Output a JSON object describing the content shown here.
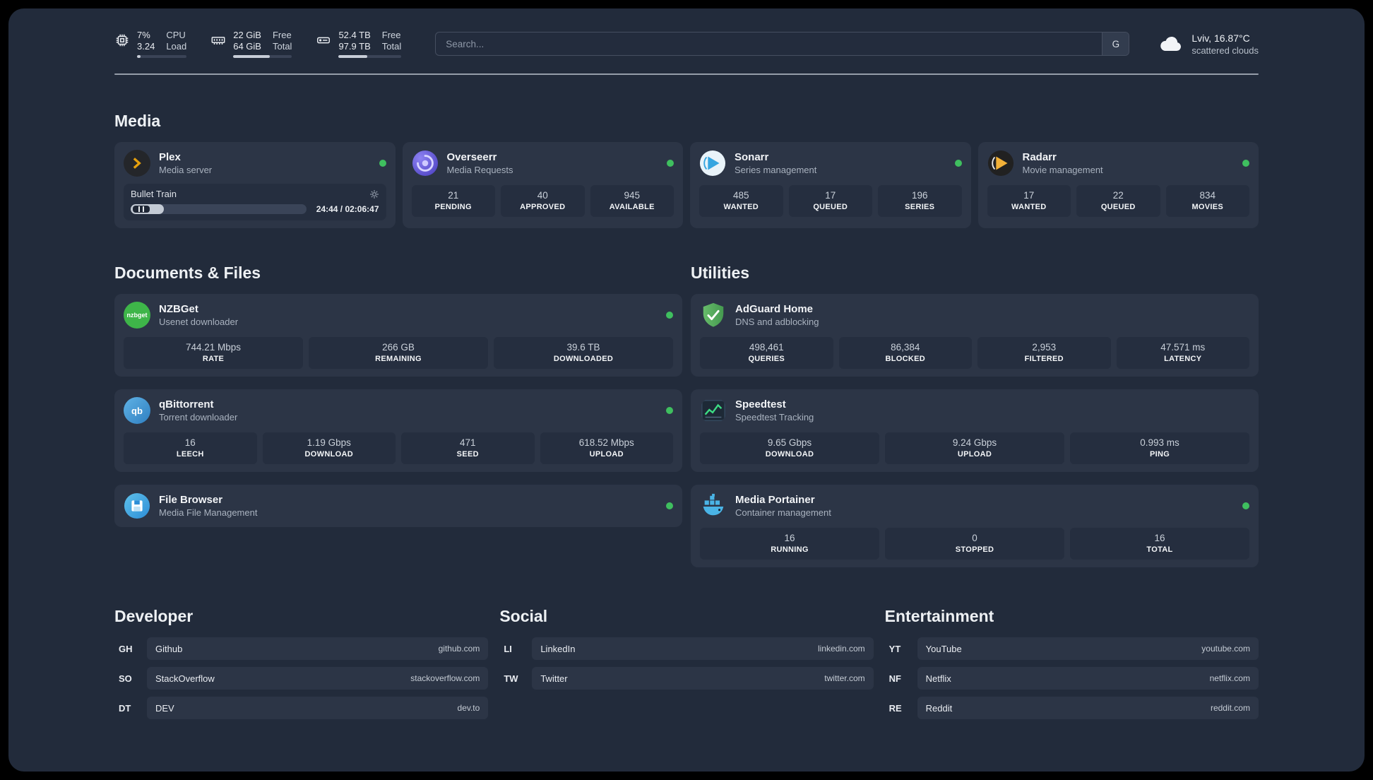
{
  "topbar": {
    "cpu": {
      "value_top": "7%",
      "label_top": "CPU",
      "value_bottom": "3.24",
      "label_bottom": "Load",
      "bar_percent": 7
    },
    "ram": {
      "value_top": "22 GiB",
      "label_top": "Free",
      "value_bottom": "64 GiB",
      "label_bottom": "Total",
      "bar_percent": 62
    },
    "disk": {
      "value_top": "52.4 TB",
      "label_top": "Free",
      "value_bottom": "97.9 TB",
      "label_bottom": "Total",
      "bar_percent": 46
    },
    "search": {
      "placeholder": "Search...",
      "button": "G"
    },
    "weather": {
      "location": "Lviv, 16.87°C",
      "condition": "scattered clouds"
    }
  },
  "sections": {
    "media": "Media",
    "documents": "Documents & Files",
    "utilities": "Utilities",
    "developer": "Developer",
    "social": "Social",
    "entertainment": "Entertainment"
  },
  "media": {
    "plex": {
      "name": "Plex",
      "desc": "Media server",
      "now_playing": "Bullet Train",
      "time": "24:44 / 02:06:47",
      "progress_percent": 19
    },
    "overseerr": {
      "name": "Overseerr",
      "desc": "Media Requests",
      "stats": [
        {
          "value": "21",
          "label": "PENDING"
        },
        {
          "value": "40",
          "label": "APPROVED"
        },
        {
          "value": "945",
          "label": "AVAILABLE"
        }
      ]
    },
    "sonarr": {
      "name": "Sonarr",
      "desc": "Series management",
      "stats": [
        {
          "value": "485",
          "label": "WANTED"
        },
        {
          "value": "17",
          "label": "QUEUED"
        },
        {
          "value": "196",
          "label": "SERIES"
        }
      ]
    },
    "radarr": {
      "name": "Radarr",
      "desc": "Movie management",
      "stats": [
        {
          "value": "17",
          "label": "WANTED"
        },
        {
          "value": "22",
          "label": "QUEUED"
        },
        {
          "value": "834",
          "label": "MOVIES"
        }
      ]
    }
  },
  "documents": {
    "nzbget": {
      "name": "NZBGet",
      "desc": "Usenet downloader",
      "icon_text": "nzbget",
      "stats": [
        {
          "value": "744.21 Mbps",
          "label": "RATE"
        },
        {
          "value": "266 GB",
          "label": "REMAINING"
        },
        {
          "value": "39.6 TB",
          "label": "DOWNLOADED"
        }
      ]
    },
    "qbittorrent": {
      "name": "qBittorrent",
      "desc": "Torrent downloader",
      "icon_text": "qb",
      "stats": [
        {
          "value": "16",
          "label": "LEECH"
        },
        {
          "value": "1.19 Gbps",
          "label": "DOWNLOAD"
        },
        {
          "value": "471",
          "label": "SEED"
        },
        {
          "value": "618.52 Mbps",
          "label": "UPLOAD"
        }
      ]
    },
    "filebrowser": {
      "name": "File Browser",
      "desc": "Media File Management"
    }
  },
  "utilities": {
    "adguard": {
      "name": "AdGuard Home",
      "desc": "DNS and adblocking",
      "stats": [
        {
          "value": "498,461",
          "label": "QUERIES"
        },
        {
          "value": "86,384",
          "label": "BLOCKED"
        },
        {
          "value": "2,953",
          "label": "FILTERED"
        },
        {
          "value": "47.571 ms",
          "label": "LATENCY"
        }
      ]
    },
    "speedtest": {
      "name": "Speedtest",
      "desc": "Speedtest Tracking",
      "stats": [
        {
          "value": "9.65 Gbps",
          "label": "DOWNLOAD"
        },
        {
          "value": "9.24 Gbps",
          "label": "UPLOAD"
        },
        {
          "value": "0.993 ms",
          "label": "PING"
        }
      ]
    },
    "portainer": {
      "name": "Media Portainer",
      "desc": "Container management",
      "stats": [
        {
          "value": "16",
          "label": "RUNNING"
        },
        {
          "value": "0",
          "label": "STOPPED"
        },
        {
          "value": "16",
          "label": "TOTAL"
        }
      ]
    }
  },
  "bookmarks": {
    "developer": [
      {
        "abbr": "GH",
        "name": "Github",
        "domain": "github.com"
      },
      {
        "abbr": "SO",
        "name": "StackOverflow",
        "domain": "stackoverflow.com"
      },
      {
        "abbr": "DT",
        "name": "DEV",
        "domain": "dev.to"
      }
    ],
    "social": [
      {
        "abbr": "LI",
        "name": "LinkedIn",
        "domain": "linkedin.com"
      },
      {
        "abbr": "TW",
        "name": "Twitter",
        "domain": "twitter.com"
      }
    ],
    "entertainment": [
      {
        "abbr": "YT",
        "name": "YouTube",
        "domain": "youtube.com"
      },
      {
        "abbr": "NF",
        "name": "Netflix",
        "domain": "netflix.com"
      },
      {
        "abbr": "RE",
        "name": "Reddit",
        "domain": "reddit.com"
      }
    ]
  },
  "colors": {
    "status_green": "#3fbf5f",
    "plex_orange": "#e5a00d"
  }
}
